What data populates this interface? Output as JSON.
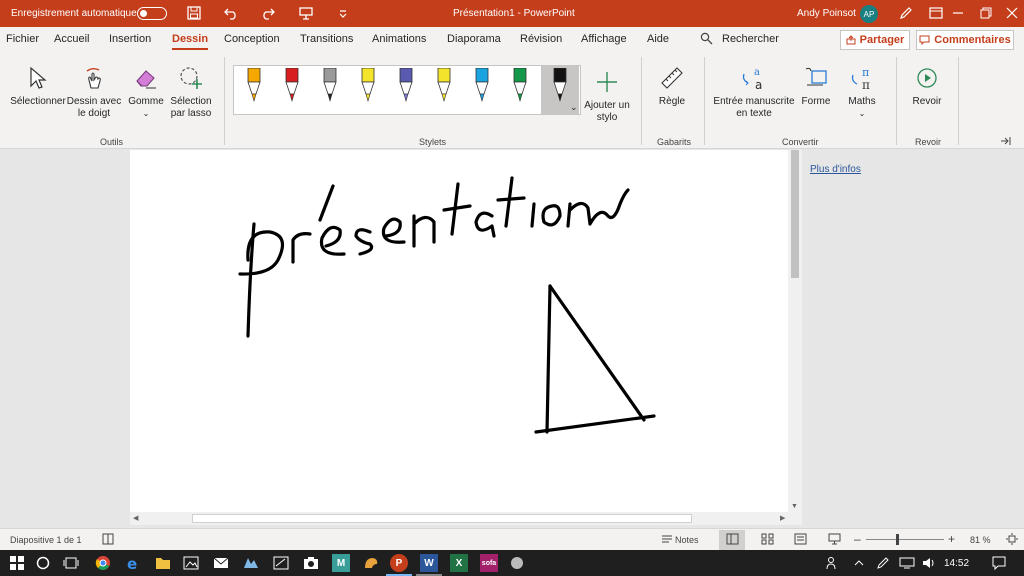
{
  "titlebar": {
    "autosave_label": "Enregistrement automatique",
    "doc_title": "Présentation1  -  PowerPoint",
    "user_name": "Andy Poinsot",
    "user_initials": "AP"
  },
  "tabs": [
    "Fichier",
    "Accueil",
    "Insertion",
    "Dessin",
    "Conception",
    "Transitions",
    "Animations",
    "Diaporama",
    "Révision",
    "Affichage",
    "Aide"
  ],
  "search_label": "Rechercher",
  "share_label": "Partager",
  "comments_label": "Commentaires",
  "ribbon": {
    "outils": {
      "select": "Sélectionner",
      "finger_1": "Dessin avec",
      "finger_2": "le doigt",
      "eraser": "Gomme",
      "lasso_1": "Sélection",
      "lasso_2": "par lasso",
      "group": "Outils"
    },
    "stylets": {
      "add_pen_1": "Ajouter un",
      "add_pen_2": "stylo",
      "group": "Stylets"
    },
    "gabarits": {
      "ruler": "Règle",
      "group": "Gabarits"
    },
    "convertir": {
      "ink_text_1": "Entrée manuscrite",
      "ink_text_2": "en texte",
      "shape": "Forme",
      "math": "Maths",
      "group": "Convertir"
    },
    "revoir": {
      "replay": "Revoir",
      "group": "Revoir"
    }
  },
  "pens": [
    {
      "color": "#f7a800",
      "tip": "#f7a800"
    },
    {
      "color": "#d81e1e",
      "tip": "#d81e1e"
    },
    {
      "color": "#9a9a9a",
      "tip": "#222222"
    },
    {
      "color": "#f4e32b",
      "tip": "#f4e32b"
    },
    {
      "color": "#5a5ab0",
      "tip": "#7b7bd6"
    },
    {
      "color": "#f4e32b",
      "tip": "#f4e32b"
    },
    {
      "color": "#19a3e0",
      "tip": "#19a3e0"
    },
    {
      "color": "#14994a",
      "tip": "#14994a"
    },
    {
      "color": "#111111",
      "tip": "#111111"
    }
  ],
  "panel": {
    "more_info": "Plus d'infos"
  },
  "status": {
    "slide_info": "Diapositive 1 de 1",
    "notes": "Notes",
    "zoom": "81 %"
  },
  "taskbar": {
    "time": "14:52"
  },
  "colors": {
    "accent": "#c43e1c"
  }
}
